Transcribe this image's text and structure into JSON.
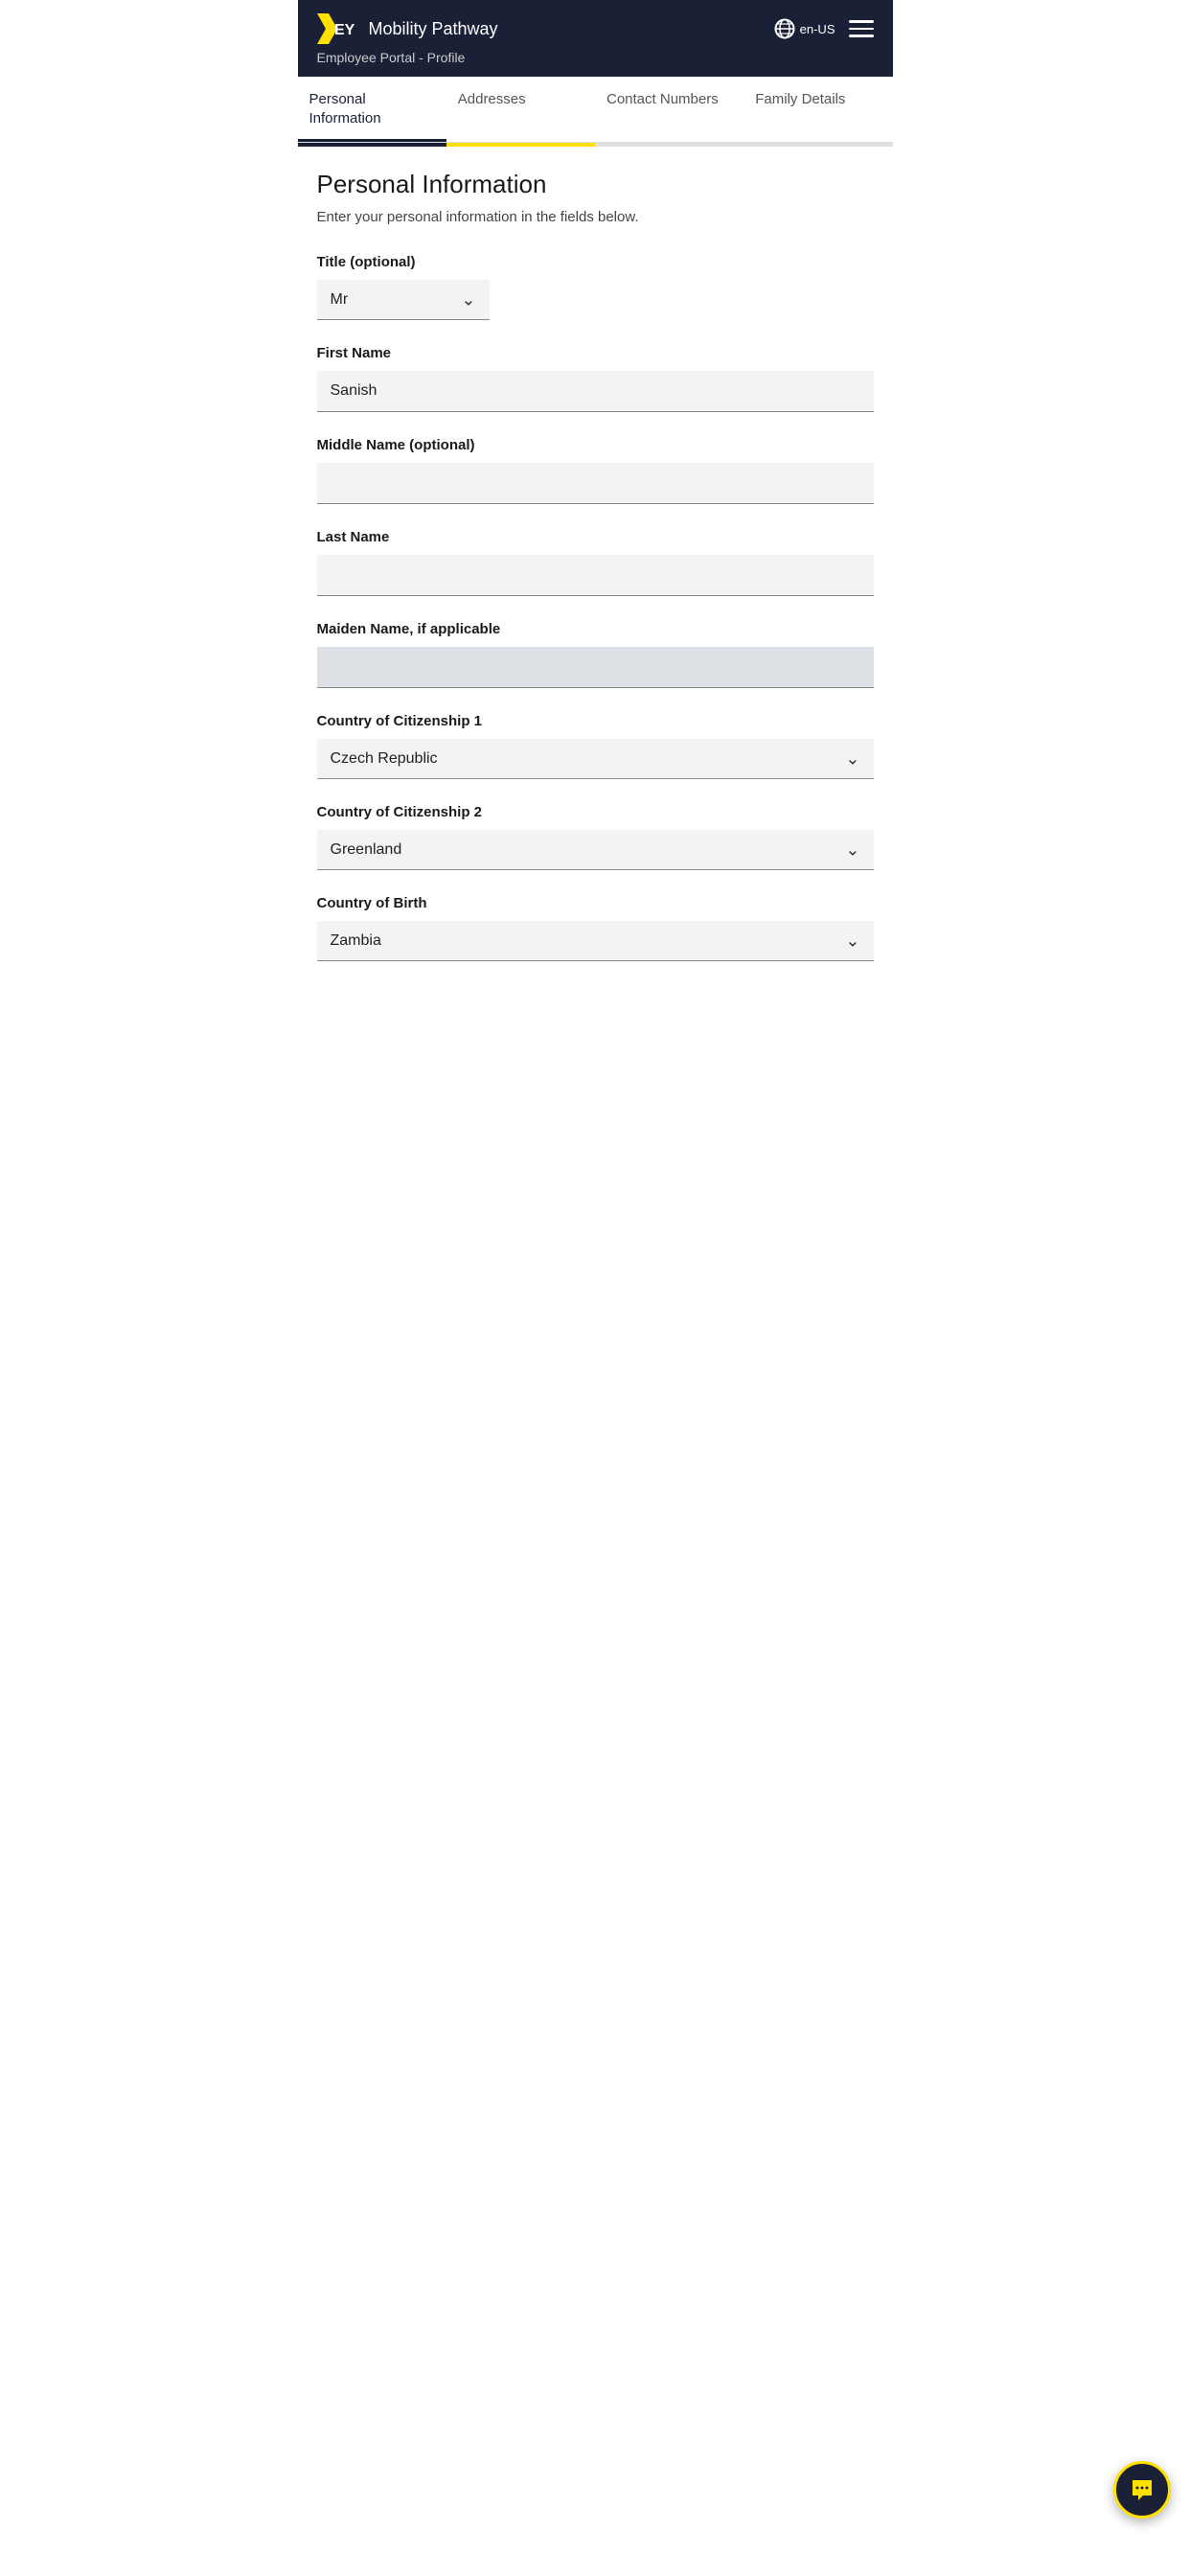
{
  "header": {
    "app_title": "Mobility Pathway",
    "subtitle": "Employee Portal - Profile",
    "lang": "en-US"
  },
  "nav": {
    "tabs": [
      {
        "id": "personal-info",
        "label": "Personal Information",
        "active": true
      },
      {
        "id": "addresses",
        "label": "Addresses",
        "active": false
      },
      {
        "id": "contact-numbers",
        "label": "Contact Numbers",
        "active": false
      },
      {
        "id": "family-details",
        "label": "Family Details",
        "active": false
      }
    ]
  },
  "page": {
    "title": "Personal Information",
    "subtitle": "Enter your personal information in the fields below."
  },
  "fields": {
    "title_label": "Title (optional)",
    "title_value": "Mr",
    "first_name_label": "First Name",
    "first_name_value": "Sanish",
    "middle_name_label": "Middle Name (optional)",
    "middle_name_value": "",
    "last_name_label": "Last Name",
    "last_name_value": "",
    "maiden_name_label": "Maiden Name, if applicable",
    "maiden_name_value": "",
    "citizenship1_label": "Country of Citizenship 1",
    "citizenship1_value": "Czech Republic",
    "citizenship2_label": "Country of Citizenship 2",
    "citizenship2_value": "Greenland",
    "birth_country_label": "Country of Birth",
    "birth_country_value": "Zambia"
  },
  "chat_fab_label": "chat"
}
